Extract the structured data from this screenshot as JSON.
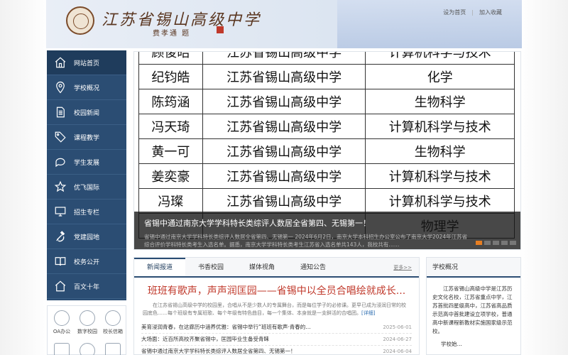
{
  "header": {
    "site_title": "江苏省锡山高级中学",
    "calligrapher": "费孝通 题",
    "links": [
      "设为首页",
      "加入收藏"
    ]
  },
  "sidebar": {
    "items": [
      {
        "label": "网站首页",
        "icon": "home-icon"
      },
      {
        "label": "学校概况",
        "icon": "location-pin-icon"
      },
      {
        "label": "校园新闻",
        "icon": "document-icon"
      },
      {
        "label": "课程教学",
        "icon": "tag-icon"
      },
      {
        "label": "学生发展",
        "icon": "chat-bubble-icon"
      },
      {
        "label": "优飞国际",
        "icon": "star-icon"
      },
      {
        "label": "招生专栏",
        "icon": "monitor-icon"
      },
      {
        "label": "党建园地",
        "icon": "hammer-sickle-icon"
      },
      {
        "label": "校务公开",
        "icon": "book-icon"
      },
      {
        "label": "百文十年",
        "icon": "home-icon"
      }
    ]
  },
  "tools": [
    {
      "label": "OA办公"
    },
    {
      "label": "数字校园"
    },
    {
      "label": "校长信箱"
    }
  ],
  "slider": {
    "table_rows": [
      [
        "顾俊皓",
        "江苏省锡山高级中学",
        "计算机科学与技术"
      ],
      [
        "纪钧皓",
        "江苏省锡山高级中学",
        "化学"
      ],
      [
        "陈筠涵",
        "江苏省锡山高级中学",
        "生物科学"
      ],
      [
        "冯天琦",
        "江苏省锡山高级中学",
        "计算机科学与技术"
      ],
      [
        "黄一可",
        "江苏省锡山高级中学",
        "生物科学"
      ],
      [
        "姜奕豪",
        "江苏省锡山高级中学",
        "计算机科学与技术"
      ],
      [
        "冯璨",
        "江苏省锡山高级中学",
        "计算机科学与技术"
      ],
      [
        "",
        "",
        "物理学"
      ]
    ],
    "caption_title": "省锡中通过南京大学学科特长类综评人数居全省第四、无锡第一！",
    "caption_text": "省锡中通过南京大学学科特长类综评人数居全省第四、无锡第一 2024年6月2日，南京大学本科招生办公室公布了南京大学2024年江苏省综合评价学科特长类考生入选名单。据悉，南京大学学科特长类考生江苏省入选名单共143人，我校共有……",
    "active_dot": 0,
    "dot_count": 5
  },
  "news": {
    "tabs": [
      "新闻报道",
      "书香校园",
      "媒体视角",
      "通知公告"
    ],
    "active_tab": 0,
    "more": "更多>>",
    "headline": "班班有歌声，声声润匡园——省锡中以全员合唱绘就成长...",
    "summary": "在江苏省锡山高级中学的校园里，合唱从不是少数人的专属舞台，而是每位学子的必修课。更早已成为浸润日常的校园底色……每个班级有专属班歌、每个年级有特色曲目，每一个集体、本身就是一支鲜活的合唱团。",
    "detail_link": "[详细]",
    "items": [
      {
        "title": "美育浸润青春，在这廊历中涵养优雅：省锡中举行“班班有歌声·青春的…",
        "date": "2025-06-01"
      },
      {
        "title": "大场面：近百所高校齐聚省锡中，匡园毕业生备受青睐",
        "date": "2024-06-27"
      },
      {
        "title": "省锡中通过南京大学学科特长类综评人数居全省第四、无锡第一！",
        "date": "2024-06-04"
      }
    ]
  },
  "profile": {
    "title": "学校概况",
    "text": "江苏省锡山高级中学是江苏历史文化名校，江苏省重点中学，江苏首批四星级高中，江苏省高品质示范高中首批建设立项学校，普通高中新课程新教材实施国家级示范校。",
    "more": "学校始…"
  }
}
